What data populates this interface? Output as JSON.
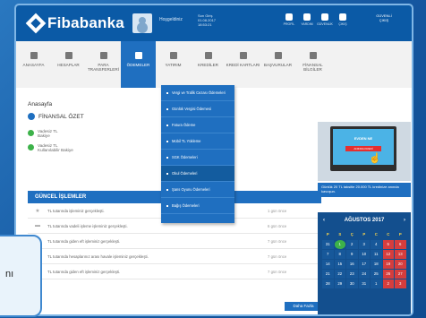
{
  "header": {
    "brand": "Fibabanka",
    "welcome": "Hoşgeldiniz",
    "last_login_label": "Son Giriş",
    "last_login_date": "01.08.2017",
    "last_login_time": "18:53:21",
    "tools": [
      {
        "label": "PROFİL",
        "icon": "profile-icon"
      },
      {
        "label": "YARDIM",
        "icon": "help-icon"
      },
      {
        "label": "GÜVENLİK",
        "icon": "lock-icon"
      },
      {
        "label": "ÇIKIŞ",
        "icon": "logout-icon"
      }
    ],
    "exit_label": "GÜVENLİ ÇIKIŞ"
  },
  "nav": [
    {
      "label": "ANASAYFA",
      "icon": "home-icon"
    },
    {
      "label": "HESAPLAR",
      "icon": "accounts-icon"
    },
    {
      "label": "PARA TRANSFERLERİ",
      "icon": "transfer-icon"
    },
    {
      "label": "ÖDEMELER",
      "icon": "payments-icon",
      "active": true
    },
    {
      "label": "YATIRIM",
      "icon": "investment-icon"
    },
    {
      "label": "KREDİLER",
      "icon": "credit-icon"
    },
    {
      "label": "KREDİ KARTLARI",
      "icon": "card-icon"
    },
    {
      "label": "BAŞVURULAR",
      "icon": "application-icon"
    },
    {
      "label": "FİNANSAL BİLGİLER",
      "icon": "info-icon"
    }
  ],
  "page": {
    "breadcrumb": "Anasayfa",
    "section_title": "FİNANSAL ÖZET",
    "accounts": [
      {
        "line1": "Vadesiz TL",
        "line2": "Bakiye"
      },
      {
        "line1": "Vadesiz TL",
        "line2": "Kullanılabilir Bakiye"
      }
    ]
  },
  "dropdown": [
    "Vergi ve Trafik Cezası Ödemeleri",
    "Günlük Vergisi Ödemesi",
    "Fatura Ödeme",
    "Mobil TL Yükleme",
    "SGK Ödemeleri",
    "Okul Ödemeleri",
    "Şans Oyunu Ödemeleri",
    "Bağış Ödemeleri"
  ],
  "dropdown_selected": 5,
  "transactions": {
    "title": "GÜNCEL İŞLEMLER",
    "rows": [
      {
        "desc": "TL tutarında işleminiz gerçekleşti.",
        "time": "1 gün önce",
        "icon": "star-icon"
      },
      {
        "desc": "TL tutarında vadeli işleme işleminiz gerçekleşti.",
        "time": "6 gün önce",
        "icon": "deposit-icon"
      },
      {
        "desc": "TL tutarında giden eft işleminiz gerçekleşti.",
        "time": "7 gün önce",
        "icon": "eft-icon"
      },
      {
        "desc": "TL tutarında hesaplarınız arası havale işleminiz gerçekleşti.",
        "time": "7 gün önce",
        "icon": "transfer-icon"
      },
      {
        "desc": "TL tutarında giden eft işleminiz gerçekleşti.",
        "time": "7 gün önce",
        "icon": "eft-icon"
      }
    ],
    "more_label": "Daha Fazla"
  },
  "promo": {
    "screen_title": "EVDEN NE",
    "screen_button": "ANINDA KREDİ",
    "text": "Günlük 20 TL taksitle 20.000 TL kredinize anında kavuşun."
  },
  "calendar": {
    "title": "AĞUSTOS 2017",
    "days_header": [
      "P",
      "S",
      "Ç",
      "P",
      "C",
      "C",
      "P"
    ],
    "days": [
      "31",
      "1",
      "2",
      "3",
      "4",
      "5",
      "6",
      "7",
      "8",
      "9",
      "10",
      "11",
      "12",
      "13",
      "14",
      "15",
      "16",
      "17",
      "18",
      "19",
      "20",
      "21",
      "22",
      "23",
      "24",
      "25",
      "26",
      "27",
      "28",
      "29",
      "30",
      "31",
      "1",
      "2",
      "3"
    ],
    "today": "1"
  },
  "bubble_text": "nı"
}
